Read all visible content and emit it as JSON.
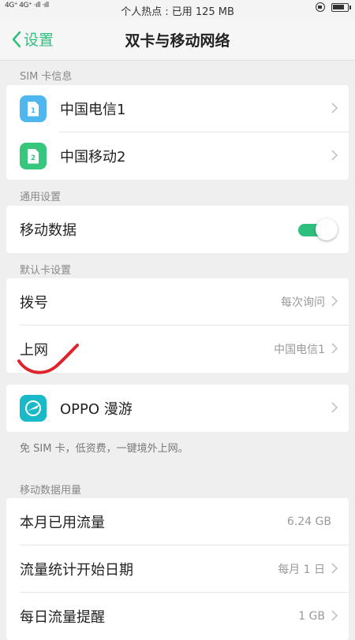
{
  "colors": {
    "accent": "#2fbf7d",
    "sim1": "#4fb6f0",
    "sim2": "#37c77c",
    "roaming": "#19b9c7",
    "annotation": "#e0222d"
  },
  "status_bar": {
    "network_text": "4G⁺ 4G⁺ ·ıll ·ıll",
    "center_text": "个人热点 : 已用 125 MB",
    "battery_level": 0.85
  },
  "nav": {
    "back_label": "设置",
    "title": "双卡与移动网络"
  },
  "sim_section": {
    "header": "SIM 卡信息",
    "items": [
      {
        "label": "中国电信1",
        "icon": "sim-card-icon",
        "number": "1"
      },
      {
        "label": "中国移动2",
        "icon": "sim-card-icon",
        "number": "2"
      }
    ]
  },
  "general_section": {
    "header": "通用设置",
    "mobile_data": {
      "label": "移动数据",
      "enabled": true
    }
  },
  "default_section": {
    "header": "默认卡设置",
    "dial": {
      "label": "拨号",
      "value": "每次询问"
    },
    "internet": {
      "label": "上网",
      "value": "中国电信1"
    }
  },
  "roaming": {
    "label": "OPPO 漫游",
    "icon": "globe-plane-icon",
    "note": "免 SIM 卡，低资费，一键境外上网。"
  },
  "usage_section": {
    "header": "移动数据用量",
    "monthly": {
      "label": "本月已用流量",
      "value": "6.24 GB"
    },
    "start_date": {
      "label": "流量统计开始日期",
      "value": "每月 1 日"
    },
    "daily_alert": {
      "label": "每日流量提醒",
      "value": "1 GB"
    }
  }
}
